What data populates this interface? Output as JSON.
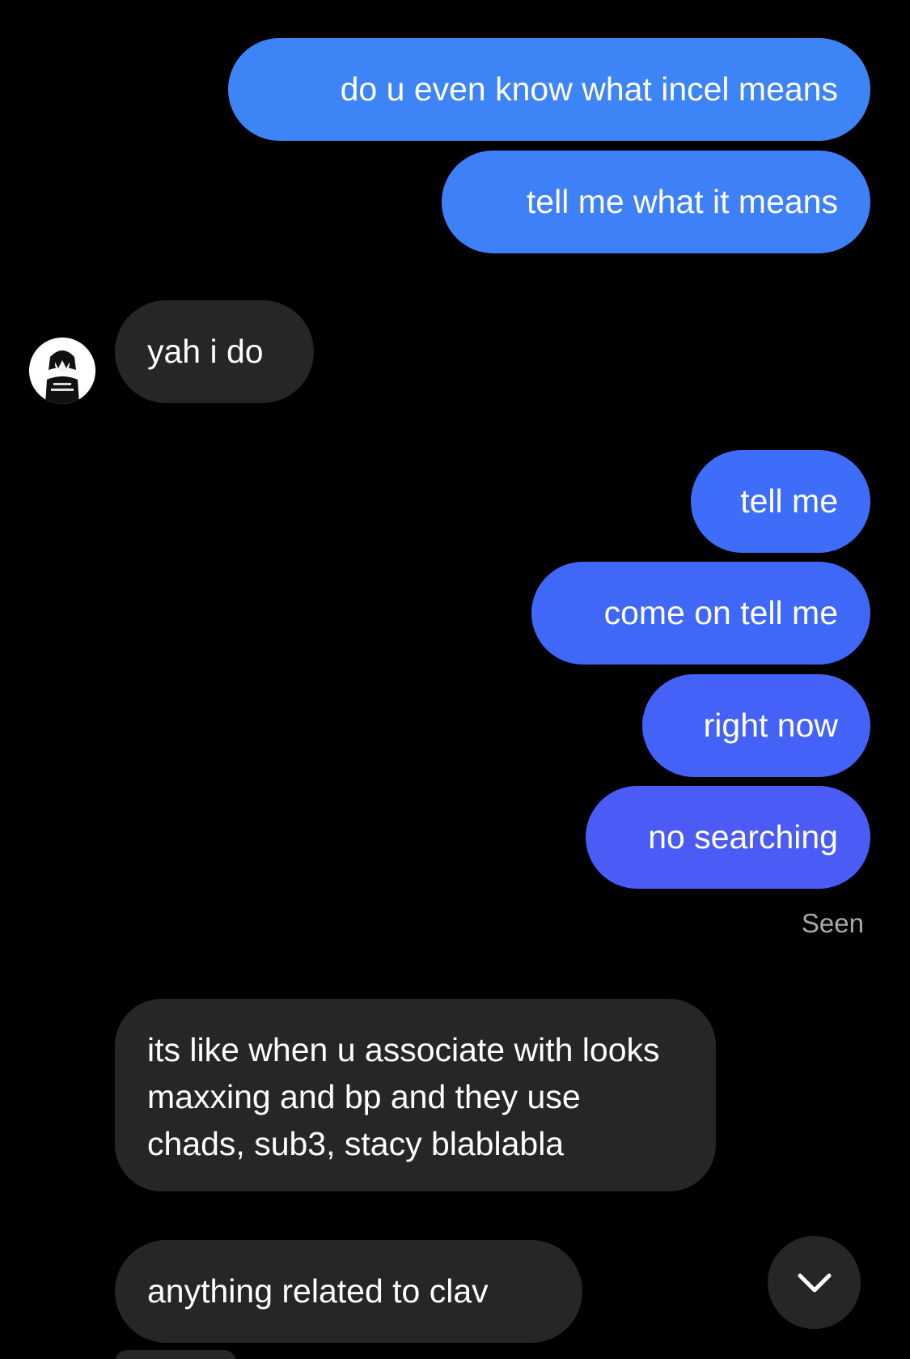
{
  "conversation": {
    "sent_group_1": [
      {
        "text": "do u even know what incel means",
        "color": "#3d84f7"
      },
      {
        "text": "tell me what it means",
        "color": "#3e80f8"
      }
    ],
    "received_1": {
      "text": "yah i do"
    },
    "sent_group_2": [
      {
        "text": "tell me",
        "color": "#3e6ef9"
      },
      {
        "text": "come on tell me",
        "color": "#3f68f9"
      },
      {
        "text": "right now",
        "color": "#4562f8"
      },
      {
        "text": "no searching",
        "color": "#4b5bf6"
      }
    ],
    "status": "Seen",
    "received_2": [
      {
        "text": "its like when u associate with looks maxxing and bp and they use chads, sub3, stacy blablabla"
      },
      {
        "text": "anything related to clav"
      }
    ]
  },
  "controls": {
    "scroll_down_icon": "chevron-down-icon"
  },
  "colors": {
    "background": "#000000",
    "received_bubble": "#262626",
    "seen_text": "#a8a8a8"
  }
}
